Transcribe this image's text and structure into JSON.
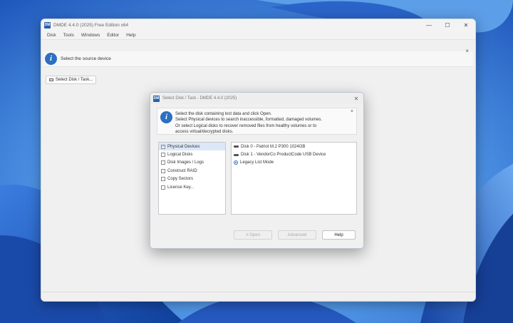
{
  "colors": {
    "accent": "#2d6fc0",
    "wallpaper": "#2f6fd1"
  },
  "app": {
    "title": "DMDE 4.4.0 (2025) Free Edition x64",
    "controls": {
      "minimize": "—",
      "maximize": "☐",
      "close": "✕"
    }
  },
  "menu": [
    "Disk",
    "Tools",
    "Windows",
    "Editor",
    "Help"
  ],
  "banner": {
    "icon": "info-icon",
    "text": "Select the source device",
    "close": "×"
  },
  "select_button": {
    "label": "Select Disk / Task...",
    "icon": "drive-icon"
  },
  "dialog": {
    "title": "Select Disk / Task - DMDE 4.4.0 (2025)",
    "close": "✕",
    "info": {
      "lines": [
        "Select the disk containing lost data and click Open.",
        "Select Physical devices to search inaccessible, formatted, damaged volumes.",
        "Or select Logical disks to recover removed files from healthy volumes or to",
        "access virtual/decrypted disks."
      ],
      "close": "×"
    },
    "left_items": [
      {
        "label": "Physical Devices",
        "checked": true,
        "selected": true
      },
      {
        "label": "Logical Disks",
        "checked": false,
        "selected": false
      },
      {
        "label": "Disk Images / Logs",
        "checked": false,
        "selected": false
      },
      {
        "label": "Construct RAID",
        "checked": false,
        "selected": false
      },
      {
        "label": "Copy Sectors",
        "checked": false,
        "selected": false
      },
      {
        "label": "License Key...",
        "checked": false,
        "selected": false
      }
    ],
    "right_items": [
      {
        "label": "Disk 0 - Patriot M.2 P300 1024GB",
        "icon": "disk-icon"
      },
      {
        "label": "Disk 1 - VendorCo ProductCode USB Device",
        "icon": "disk-icon"
      },
      {
        "label": "Legacy List Mode",
        "icon": "radio-icon"
      }
    ],
    "buttons": {
      "open": "≡ Open",
      "advanced": "Advanced",
      "help": "Help"
    }
  }
}
